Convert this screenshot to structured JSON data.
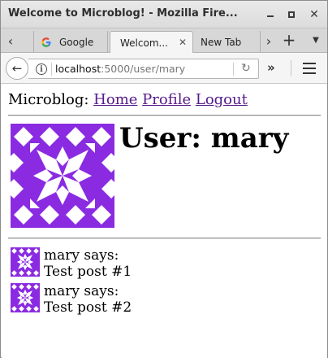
{
  "window": {
    "title": "Welcome to Microblog! - Mozilla Fire..."
  },
  "tabs": {
    "items": [
      {
        "label": "Google",
        "icon": "google-icon"
      },
      {
        "label": "Welcom...",
        "active": true
      },
      {
        "label": "New Tab"
      }
    ]
  },
  "urlbar": {
    "host": "localhost",
    "path": ":5000/user/mary"
  },
  "site": {
    "brand": "Microblog:",
    "nav": [
      "Home",
      "Profile",
      "Logout"
    ]
  },
  "profile": {
    "heading": "User: mary",
    "avatar_color": "#8a2be2"
  },
  "posts": [
    {
      "author_line": "mary says:",
      "body": "Test post #1"
    },
    {
      "author_line": "mary says:",
      "body": "Test post #2"
    }
  ],
  "colors": {
    "link_visited": "#551a8b",
    "avatar_purple": "#8a2be2"
  }
}
